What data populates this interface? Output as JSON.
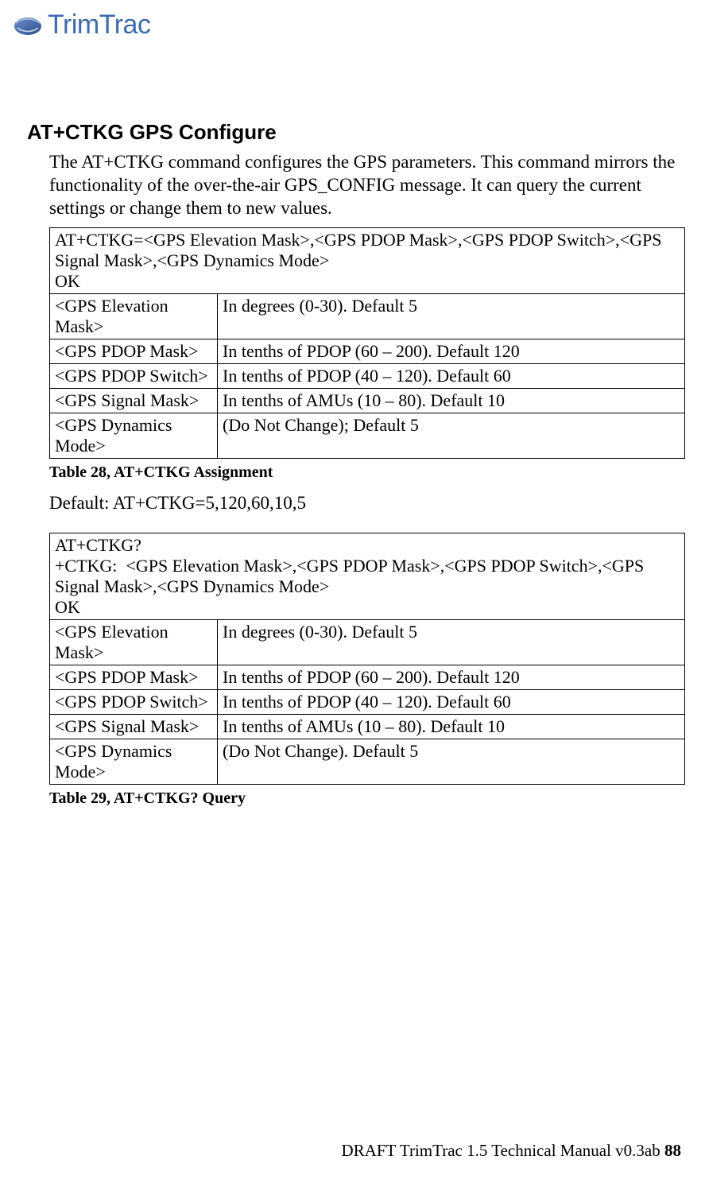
{
  "logo": {
    "text": "TrimTrac"
  },
  "section": {
    "title": "AT+CTKG GPS Configure",
    "intro": "The AT+CTKG command configures the GPS parameters.  This command mirrors the functionality of the over-the-air GPS_CONFIG message.  It can query the current settings or change them to new values."
  },
  "table1": {
    "header": "AT+CTKG=<GPS Elevation Mask>,<GPS PDOP Mask>,<GPS PDOP Switch>,<GPS Signal Mask>,<GPS Dynamics Mode>\nOK",
    "rows": [
      {
        "name": "<GPS Elevation Mask>",
        "desc": "In degrees (0-30). Default 5"
      },
      {
        "name": "<GPS PDOP Mask>",
        "desc": "In tenths of PDOP (60 – 200). Default 120"
      },
      {
        "name": "<GPS PDOP Switch>",
        "desc": "In tenths of PDOP (40 – 120). Default 60"
      },
      {
        "name": "<GPS Signal Mask>",
        "desc": "In tenths of AMUs (10 – 80). Default 10"
      },
      {
        "name": "<GPS Dynamics Mode>",
        "desc": "(Do Not Change); Default 5"
      }
    ],
    "caption": "Table 28, AT+CTKG Assignment"
  },
  "default_line": "Default:  AT+CTKG=5,120,60,10,5",
  "table2": {
    "header": "AT+CTKG?\n+CTKG:  <GPS Elevation Mask>,<GPS PDOP Mask>,<GPS PDOP Switch>,<GPS Signal Mask>,<GPS Dynamics Mode>\nOK",
    "rows": [
      {
        "name": "<GPS Elevation Mask>",
        "desc": "In degrees (0-30). Default 5"
      },
      {
        "name": "<GPS PDOP Mask>",
        "desc": "In tenths of PDOP (60 – 200). Default 120"
      },
      {
        "name": "<GPS PDOP Switch>",
        "desc": "In tenths of PDOP (40 – 120). Default 60"
      },
      {
        "name": "<GPS Signal Mask>",
        "desc": "In tenths of AMUs (10 – 80). Default 10"
      },
      {
        "name": "<GPS Dynamics Mode>",
        "desc": "(Do Not Change). Default 5"
      }
    ],
    "caption": "Table 29, AT+CTKG? Query"
  },
  "footer": {
    "text": "DRAFT TrimTrac 1.5 Technical Manual v0.3ab ",
    "page": "88"
  }
}
